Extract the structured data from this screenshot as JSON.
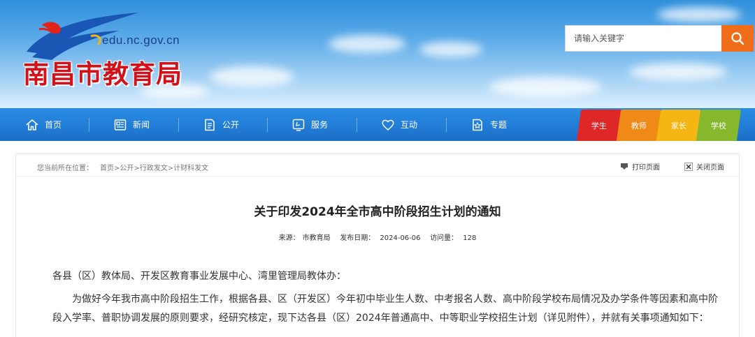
{
  "header": {
    "domain": "edu.nc.gov.cn",
    "site_name": "南昌市教育局",
    "search_placeholder": "请输入关键字",
    "search_icon": "search-icon",
    "colors": {
      "brand_red": "#d2121b",
      "search_button": "#f06d1a",
      "nav_blue": "#1b6fc9"
    }
  },
  "nav": {
    "items": [
      {
        "label": "首页",
        "icon": "home-icon"
      },
      {
        "label": "新闻",
        "icon": "newspaper-icon"
      },
      {
        "label": "公开",
        "icon": "document-icon"
      },
      {
        "label": "服务",
        "icon": "service-icon"
      },
      {
        "label": "互动",
        "icon": "heart-icon"
      },
      {
        "label": "专题",
        "icon": "star-page-icon"
      }
    ],
    "roles": [
      {
        "label": "学生",
        "color": "#e02727"
      },
      {
        "label": "教师",
        "color": "#f08a16"
      },
      {
        "label": "家长",
        "color": "#f5b614"
      },
      {
        "label": "学校",
        "color": "#86b82e"
      }
    ]
  },
  "breadcrumb": {
    "prefix": "您当前所在位置：",
    "path": "首页>公开>行政发文>计财科发文"
  },
  "toolbar": {
    "print_label": "打印页面",
    "close_label": "关闭页面"
  },
  "article": {
    "title": "关于印发2024年全市高中阶段招生计划的通知",
    "source_label": "来源：",
    "source": "市教育局",
    "date_label": "发布日期：",
    "date": "2024-06-06",
    "views_label": "访问量：",
    "views": "128",
    "paragraphs": [
      "各县（区）教体局、开发区教育事业发展中心、湾里管理局教体办：",
      "为做好今年我市高中阶段招生工作，根据各县、区（开发区）今年初中毕业生人数、中考报名人数、高中阶段学校布局情况及办学条件等因素和高中阶段入学率、普职协调发展的原则要求，经研究核定，现下达各县（区）2024年普通高中、中等职业学校招生计划（详见附件），并就有关事项通知如下："
    ]
  }
}
